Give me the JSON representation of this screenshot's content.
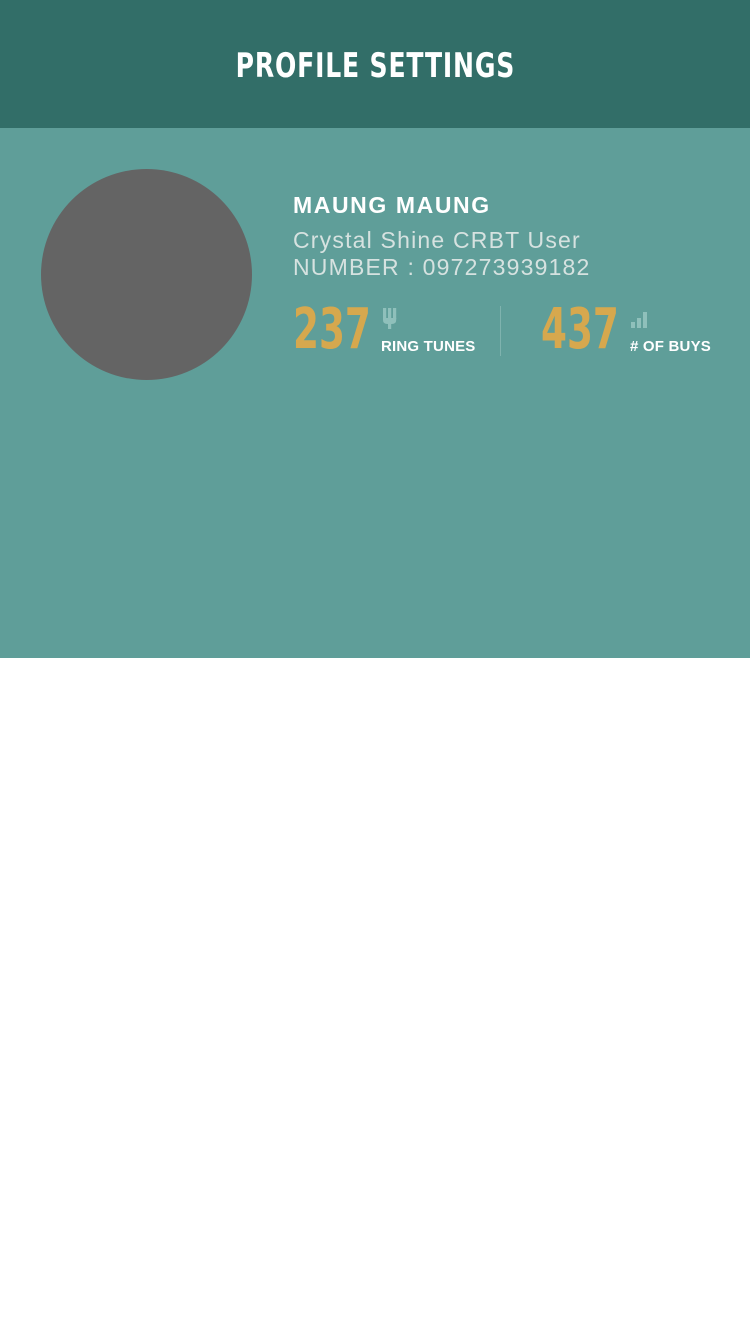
{
  "header": {
    "title": "PROFILE SETTINGS"
  },
  "profile": {
    "name": "MAUNG MAUNG",
    "role": "Crystal Shine CRBT User",
    "number_row": "NUMBER : 097273939182"
  },
  "stats": {
    "ring_tunes": {
      "value": "237",
      "label": "RING TUNES",
      "icon": "tuning-fork-icon"
    },
    "buys": {
      "value": "437",
      "label": "# OF BUYS",
      "icon": "bar-chart-icon"
    }
  },
  "colors": {
    "header_bg": "#326e68",
    "panel_bg": "#5f9e99",
    "avatar_bg": "#646464",
    "stat_value": "#d6a84e",
    "icon": "#8fc0bb"
  }
}
